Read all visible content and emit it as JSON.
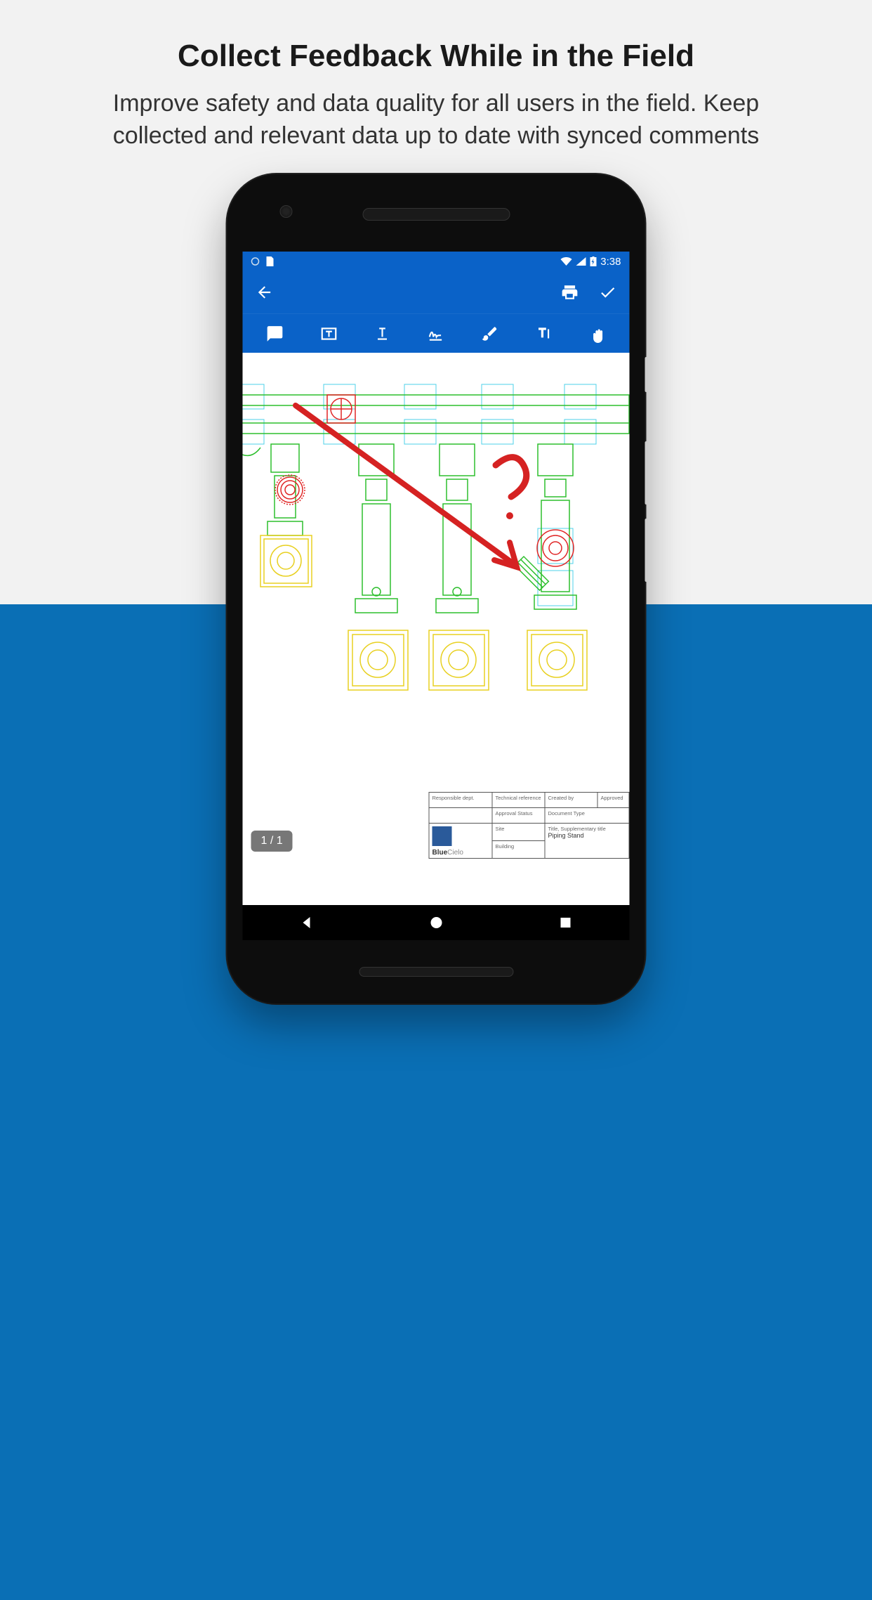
{
  "marketing": {
    "headline": "Collect Feedback While in the Field",
    "subhead": "Improve safety and data quality for all users in the field. Keep collected and relevant data up to date with synced comments"
  },
  "status": {
    "time": "3:38"
  },
  "viewer": {
    "page_counter": "1 / 1"
  },
  "titleblock": {
    "resp_dept": "Responsible dept.",
    "tech_ref": "Technical reference",
    "created_by": "Created by",
    "approved": "Approved",
    "approval_status": "Approval Status",
    "doc_type": "Document Type",
    "site": "Site",
    "building": "Building",
    "title_label": "Title, Supplementary title",
    "title_value": "Piping Stand",
    "logo_text_a": "Blue",
    "logo_text_b": "Cielo"
  }
}
